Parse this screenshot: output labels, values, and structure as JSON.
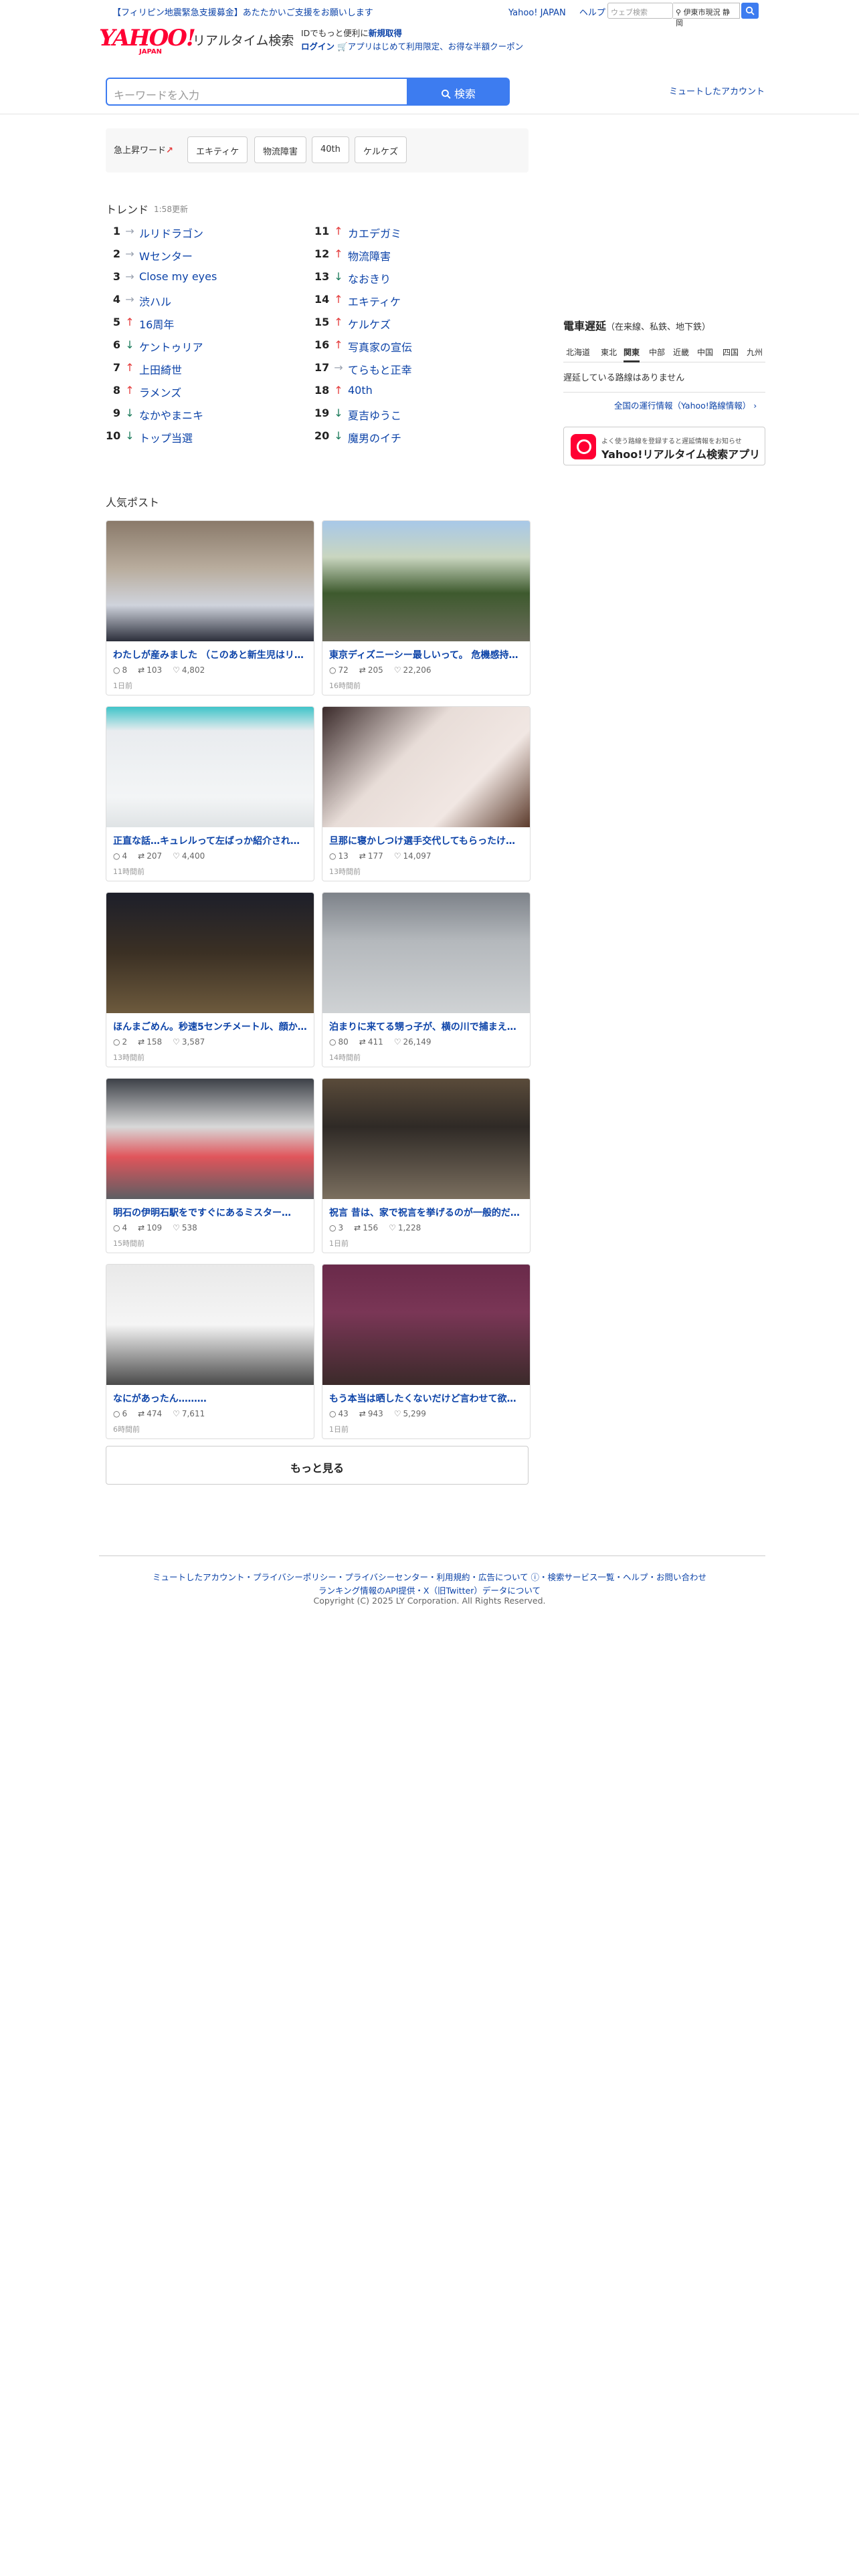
{
  "topbar": {
    "notice": "【フィリピン地震緊急支援募金】あたたかいご支援をお願いします",
    "links": [
      "Yahoo! JAPAN",
      "ヘルプ"
    ],
    "web_search_placeholder": "ウェブ検索",
    "location": "伊東市現況 静岡"
  },
  "header": {
    "logo": "YAHOO!",
    "logo_sub": "JAPAN",
    "service_name": "リアルタイム検索",
    "promo_line1_prefix": "IDでもっと便利に",
    "promo_line1_link": "新規取得",
    "promo_login": "ログイン",
    "promo_line2": "アプリはじめて利用限定、お得な半額クーポン"
  },
  "search": {
    "placeholder": "キーワードを入力",
    "button": "検索",
    "mute_link": "ミュートしたアカウント"
  },
  "rising": {
    "label": "急上昇ワード",
    "chips": [
      "エキティケ",
      "物流障害",
      "40th",
      "ケルケズ"
    ]
  },
  "trend": {
    "title": "トレンド",
    "updated": "1:58更新",
    "items": [
      {
        "rank": "1",
        "dir": "flat",
        "word": "ルリドラゴン"
      },
      {
        "rank": "2",
        "dir": "flat",
        "word": "Wセンター"
      },
      {
        "rank": "3",
        "dir": "flat",
        "word": "Close my eyes"
      },
      {
        "rank": "4",
        "dir": "flat",
        "word": "渋ハル"
      },
      {
        "rank": "5",
        "dir": "up",
        "word": "16周年"
      },
      {
        "rank": "6",
        "dir": "down",
        "word": "ケントゥリア"
      },
      {
        "rank": "7",
        "dir": "up",
        "word": "上田綺世"
      },
      {
        "rank": "8",
        "dir": "up",
        "word": "ラメンズ"
      },
      {
        "rank": "9",
        "dir": "down",
        "word": "なかやまニキ"
      },
      {
        "rank": "10",
        "dir": "down",
        "word": "トップ当選"
      },
      {
        "rank": "11",
        "dir": "up",
        "word": "カエデガミ"
      },
      {
        "rank": "12",
        "dir": "up",
        "word": "物流障害"
      },
      {
        "rank": "13",
        "dir": "down",
        "word": "なおきり"
      },
      {
        "rank": "14",
        "dir": "up",
        "word": "エキティケ"
      },
      {
        "rank": "15",
        "dir": "up",
        "word": "ケルケズ"
      },
      {
        "rank": "16",
        "dir": "up",
        "word": "写真家の宣伝"
      },
      {
        "rank": "17",
        "dir": "flat",
        "word": "てらもと正幸"
      },
      {
        "rank": "18",
        "dir": "up",
        "word": "40th"
      },
      {
        "rank": "19",
        "dir": "down",
        "word": "夏吉ゆうこ"
      },
      {
        "rank": "20",
        "dir": "down",
        "word": "魔男のイチ"
      }
    ]
  },
  "train": {
    "title": "電車遅延",
    "subtitle": "（在来線、私鉄、地下鉄）",
    "regions": [
      "北海道",
      "東北",
      "関東",
      "中部",
      "近畿",
      "中国",
      "四国",
      "九州"
    ],
    "active_region": "関東",
    "message": "遅延している路線はありません",
    "link": "全国の運行情報（Yahoo!路線情報）"
  },
  "app_banner": {
    "line1": "よく使う路線を登録すると遅延情報をお知らせ",
    "line2": "Yahoo!リアルタイム検索アプリ"
  },
  "popular": {
    "title": "人気ポスト",
    "posts": [
      {
        "title": "わたしが産みました （このあと新生児はリ…",
        "replies": "8",
        "reposts": "103",
        "likes": "4,802",
        "time": "1日前"
      },
      {
        "title": "東京ディズニーシー最しいって。 危機感持…",
        "replies": "72",
        "reposts": "205",
        "likes": "22,206",
        "time": "16時間前"
      },
      {
        "title": "正直な話…キュレルって左ばっか紹介され…",
        "replies": "4",
        "reposts": "207",
        "likes": "4,400",
        "time": "11時間前"
      },
      {
        "title": "旦那に寝かしつけ選手交代してもらったけ…",
        "replies": "13",
        "reposts": "177",
        "likes": "14,097",
        "time": "13時間前"
      },
      {
        "title": "ほんまごめん。秒速5センチメートル、顔か…",
        "replies": "2",
        "reposts": "158",
        "likes": "3,587",
        "time": "13時間前"
      },
      {
        "title": "泊まりに来てる甥っ子が、横の川で捕まえ…",
        "replies": "80",
        "reposts": "411",
        "likes": "26,149",
        "time": "14時間前"
      },
      {
        "title": "明石の伊明石駅をですぐにあるミスター…",
        "replies": "4",
        "reposts": "109",
        "likes": "538",
        "time": "15時間前"
      },
      {
        "title": "祝言 昔は、家で祝言を挙げるのが一般的だ…",
        "replies": "3",
        "reposts": "156",
        "likes": "1,228",
        "time": "1日前"
      },
      {
        "title": "なにがあったん………",
        "replies": "6",
        "reposts": "474",
        "likes": "7,611",
        "time": "6時間前"
      },
      {
        "title": "もう本当は晒したくないだけど言わせて欲…",
        "replies": "43",
        "reposts": "943",
        "likes": "5,299",
        "time": "1日前"
      }
    ],
    "more_button": "もっと見る"
  },
  "footer": {
    "links_line1": "ミュートしたアカウント・プライバシーポリシー・プライバシーセンター・利用規約・広告について ⓘ・検索サービス一覧・ヘルプ・お問い合わせ",
    "links_line2": "ランキング情報のAPI提供・X（旧Twitter）データについて",
    "copyright": "Copyright (C) 2025 LY Corporation. All Rights Reserved."
  },
  "colors": {
    "brand": "#ff0033",
    "link": "#0c43a8",
    "search_blue": "#3d7cf0",
    "trend_up": "#e43c3c",
    "trend_down": "#1a7a5a",
    "trend_flat": "#9aa2b0"
  }
}
